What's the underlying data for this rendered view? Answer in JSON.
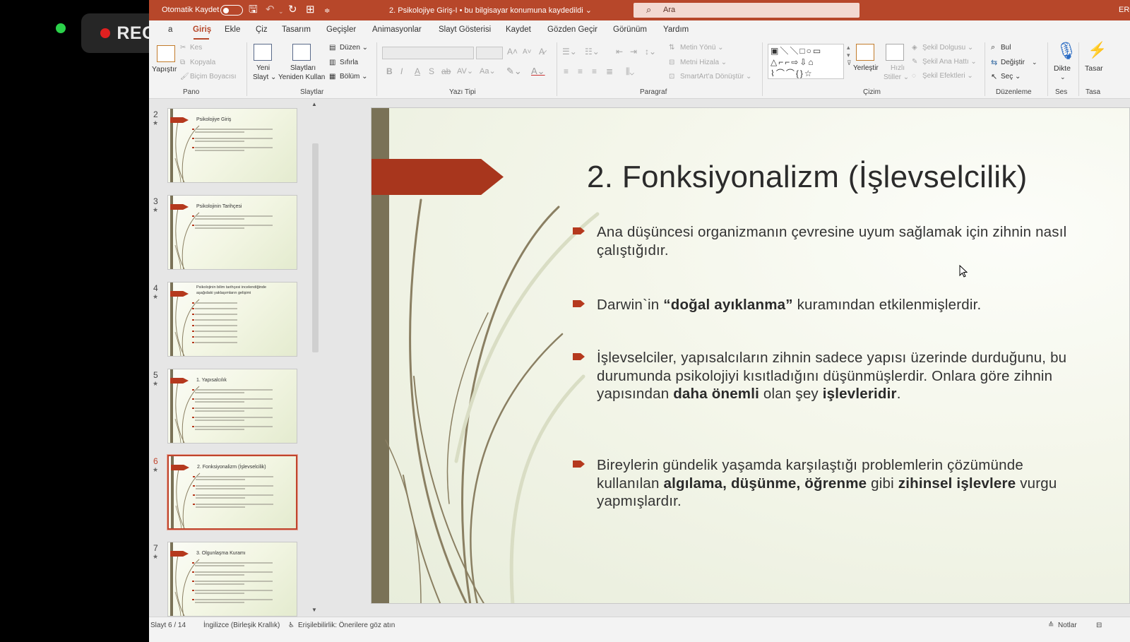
{
  "recording": {
    "label": "REC"
  },
  "titlebar": {
    "autosave_label": "Otomatik Kaydet",
    "doc_title": "2. Psikolojiye Giriş-I  •  bu bilgisayar konumuna kaydedildi ⌄",
    "search_placeholder": "Ara",
    "user_initials": "ERO"
  },
  "tabs": [
    "a",
    "Giriş",
    "Ekle",
    "Çiz",
    "Tasarım",
    "Geçişler",
    "Animasyonlar",
    "Slayt Gösterisi",
    "Kaydet",
    "Gözden Geçir",
    "Görünüm",
    "Yardım"
  ],
  "ribbon": {
    "pano": {
      "paste": "Yapıştır",
      "cut": "Kes",
      "copy": "Kopyala",
      "format_painter": "Biçim Boyacısı",
      "group": "Pano"
    },
    "slaytlar": {
      "new_slide_1": "Yeni",
      "new_slide_2": "Slayt ⌄",
      "reuse_1": "Slaytları",
      "reuse_2": "Yeniden Kullan",
      "layout": "Düzen ⌄",
      "reset": "Sıfırla",
      "section": "Bölüm ⌄",
      "group": "Slaytlar"
    },
    "yazi_tipi": {
      "group": "Yazı Tipi"
    },
    "paragraf": {
      "text_direction": "Metin Yönü ⌄",
      "align_text": "Metni Hizala ⌄",
      "smartart": "SmartArt'a Dönüştür ⌄",
      "group": "Paragraf"
    },
    "cizim": {
      "arrange": "Yerleştir",
      "quick_styles_1": "Hızlı",
      "quick_styles_2": "Stiller ⌄",
      "shape_fill": "Şekil Dolgusu ⌄",
      "shape_outline": "Şekil Ana Hattı ⌄",
      "shape_effects": "Şekil Efektleri ⌄",
      "group": "Çizim"
    },
    "duzenleme": {
      "find": "Bul",
      "replace": "Değiştir",
      "select": "Seç ⌄",
      "group": "Düzenleme"
    },
    "ses": {
      "dictate": "Dikte",
      "group": "Ses"
    },
    "tasarim": {
      "label": "Tasar",
      "group": "Tasa"
    }
  },
  "thumbnails": [
    {
      "num": "2",
      "title": "Psikolojiye Giriş",
      "lines": 3
    },
    {
      "num": "3",
      "title": "Psikolojinin Tarihçesi",
      "lines": 2
    },
    {
      "num": "4",
      "title": "Psikolojinin bilim tarihçesi incelendiğinde aşağıdaki yaklaşımların gelişimi",
      "lines": 8
    },
    {
      "num": "5",
      "title": "1. Yapısalcılık",
      "lines": 5
    },
    {
      "num": "6",
      "title": "2. Fonksiyonalizm (İşlevselcilik)",
      "lines": 4,
      "selected": true
    },
    {
      "num": "7",
      "title": "3. Olgunlaşma Kuramı",
      "lines": 5
    }
  ],
  "slide": {
    "title": "2. Fonksiyonalizm (İşlevselcilik)",
    "bullets": [
      {
        "parts": [
          {
            "t": "Ana düşüncesi organizmanın çevresine uyum sağlamak için zihnin nasıl çalıştığıdır."
          }
        ]
      },
      {
        "parts": [
          {
            "t": "Darwin`in "
          },
          {
            "t": "“doğal ayıklanma”",
            "b": true
          },
          {
            "t": " kuramından etkilenmişlerdir."
          }
        ]
      },
      {
        "parts": [
          {
            "t": "İşlevselciler, yapısalcıların zihnin sadece yapısı üzerinde durduğunu, bu durumunda psikolojiyi kısıtladığını düşünmüşlerdir. Onlara göre zihnin yapısından "
          },
          {
            "t": "daha önemli",
            "b": true
          },
          {
            "t": " olan şey "
          },
          {
            "t": "işlevleridir",
            "b": true
          },
          {
            "t": "."
          }
        ]
      },
      {
        "parts": [
          {
            "t": "Bireylerin gündelik yaşamda karşılaştığı problemlerin çözümünde kullanılan "
          },
          {
            "t": "algılama, düşünme, öğrenme",
            "b": true
          },
          {
            "t": " gibi "
          },
          {
            "t": "zihinsel işlevlere",
            "b": true
          },
          {
            "t": " vurgu yapmışlardır."
          }
        ]
      }
    ]
  },
  "statusbar": {
    "slide_counter": "Slayt 6 / 14",
    "language": "İngilizce (Birleşik Krallık)",
    "accessibility": "Erişilebilirlik: Önerilere göz atın",
    "notes": "Notlar"
  },
  "colors": {
    "accent": "#b7472a",
    "slide_flag": "#a8361d",
    "slide_bar": "#7a7257"
  }
}
